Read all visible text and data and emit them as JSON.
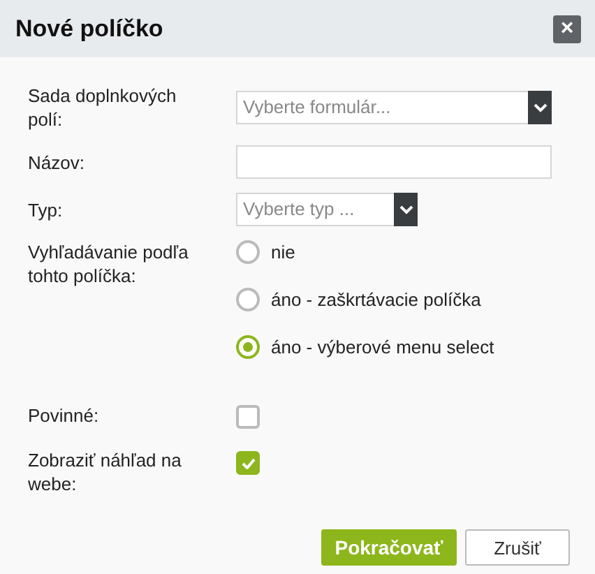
{
  "window": {
    "title": "Nové políčko",
    "close": "×"
  },
  "form": {
    "set": {
      "label": "Sada doplnkových polí:",
      "placeholder": "Vyberte formulár..."
    },
    "name": {
      "label": "Názov:"
    },
    "type": {
      "label": "Typ:",
      "placeholder": "Vyberte typ ..."
    },
    "search": {
      "label": "Vyhľadávanie podľa tohto políčka:",
      "options": [
        {
          "label": "nie",
          "selected": false
        },
        {
          "label": "áno - zaškrtávacie políčka",
          "selected": false
        },
        {
          "label": "áno - výberové menu select",
          "selected": true
        }
      ]
    },
    "required": {
      "label": "Povinné:",
      "checked": false
    },
    "preview": {
      "label": "Zobraziť náhľad na webe:",
      "checked": true
    }
  },
  "buttons": {
    "primary": "Pokračovať",
    "cancel": "Zrušiť"
  }
}
